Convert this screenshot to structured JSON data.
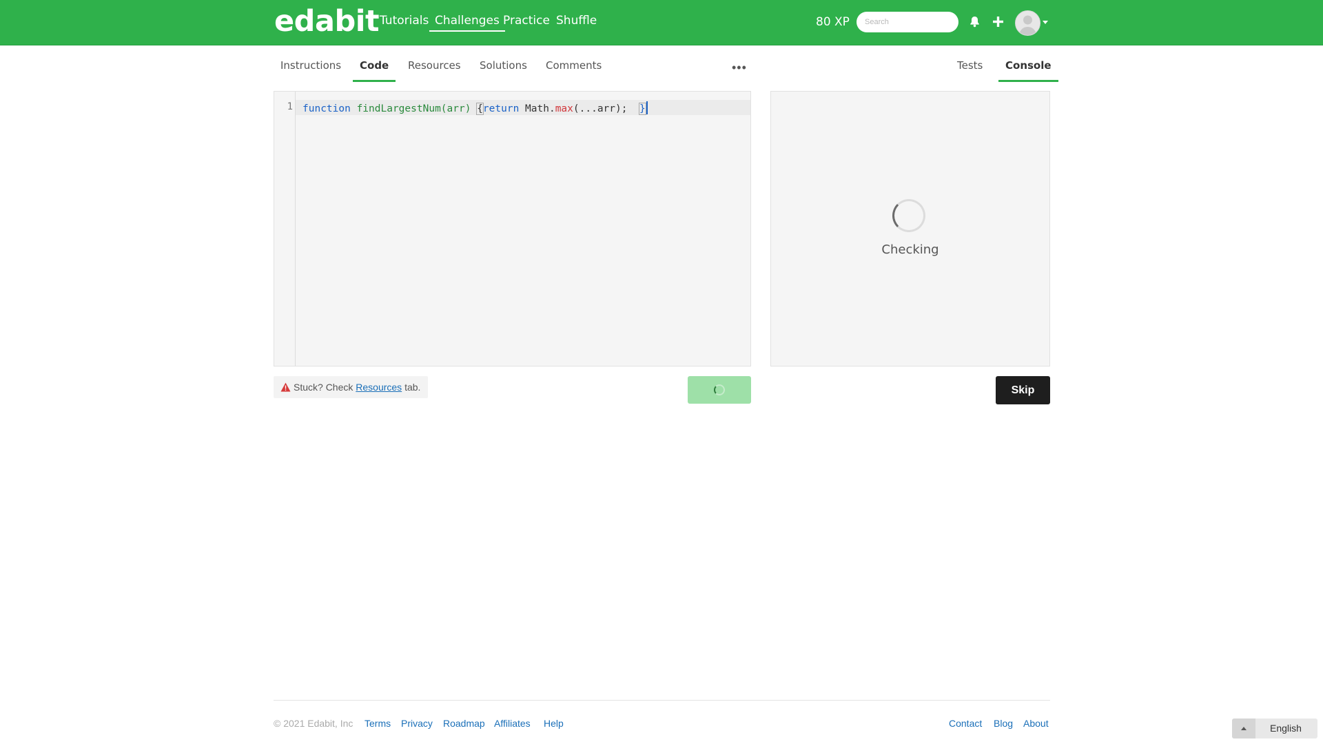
{
  "brand": {
    "logo": "edabit"
  },
  "nav": {
    "tutorials": "Tutorials",
    "challenges": "Challenges",
    "practice": "Practice",
    "shuffle": "Shuffle"
  },
  "user": {
    "xp": "80 XP"
  },
  "search": {
    "placeholder": "Search"
  },
  "left_tabs": {
    "instructions": "Instructions",
    "code": "Code",
    "resources": "Resources",
    "solutions": "Solutions",
    "comments": "Comments",
    "more": "•••"
  },
  "right_tabs": {
    "tests": "Tests",
    "console": "Console"
  },
  "editor": {
    "line_number": "1",
    "tokens": {
      "kw_function": "function",
      "fn_name": "findLargestNum",
      "params": "(arr)",
      "open_brace": "{",
      "kw_return": "return",
      "math": "Math.",
      "max": "max",
      "args": "(...arr);",
      "close_brace": "}"
    }
  },
  "console": {
    "status": "Checking"
  },
  "hint": {
    "prefix": "Stuck? Check",
    "link": "Resources",
    "suffix": "tab."
  },
  "actions": {
    "skip": "Skip"
  },
  "footer": {
    "copyright": "© 2021 Edabit, Inc",
    "terms": "Terms",
    "privacy": "Privacy",
    "roadmap": "Roadmap",
    "affiliates": "Affiliates",
    "help": "Help",
    "contact": "Contact",
    "blog": "Blog",
    "about": "About",
    "language": "English"
  },
  "colors": {
    "brand_green": "#2fb14b",
    "run_button_loading": "#9ee0a8",
    "skip_button": "#1e1e1e",
    "link_blue": "#1a6fb8"
  }
}
